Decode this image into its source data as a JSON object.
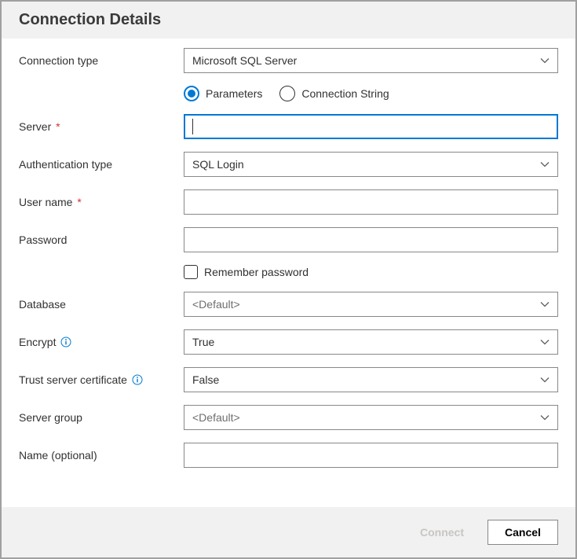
{
  "title": "Connection Details",
  "labels": {
    "connection_type": "Connection type",
    "server": "Server",
    "auth_type": "Authentication type",
    "user_name": "User name",
    "password": "Password",
    "remember_password": "Remember password",
    "database": "Database",
    "encrypt": "Encrypt",
    "trust_cert": "Trust server certificate",
    "server_group": "Server group",
    "name_optional": "Name (optional)"
  },
  "values": {
    "connection_type": "Microsoft SQL Server",
    "input_mode_parameters": "Parameters",
    "input_mode_connstring": "Connection String",
    "server": "",
    "auth_type": "SQL Login",
    "user_name": "",
    "password": "",
    "remember_password": false,
    "database": "<Default>",
    "encrypt": "True",
    "trust_cert": "False",
    "server_group": "<Default>",
    "name_optional": ""
  },
  "buttons": {
    "connect": "Connect",
    "cancel": "Cancel"
  }
}
